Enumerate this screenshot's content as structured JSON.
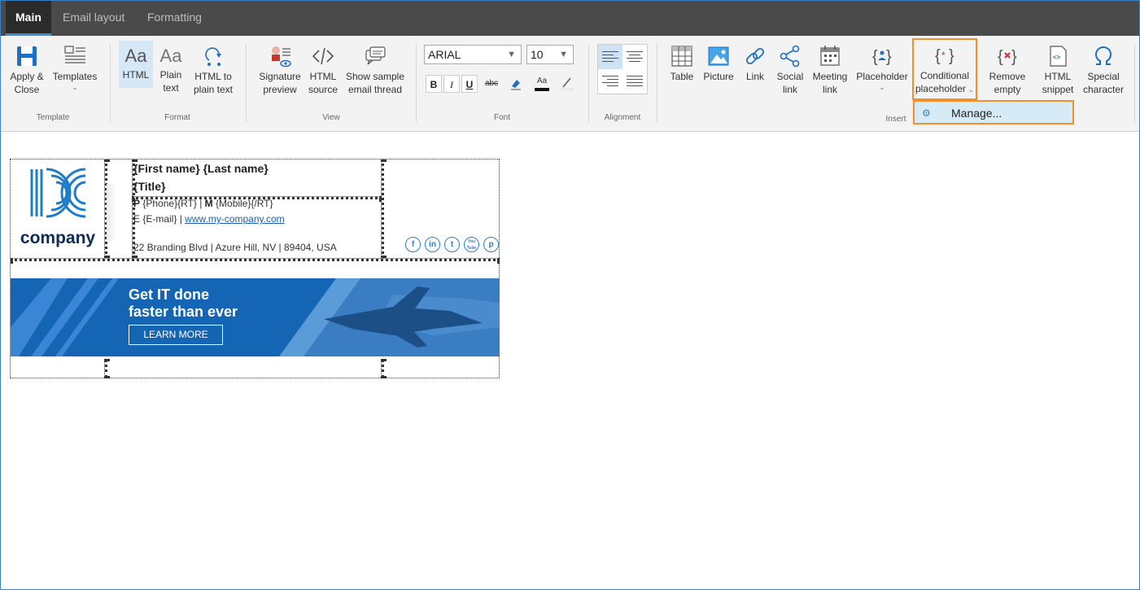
{
  "tabs": [
    "Main",
    "Email layout",
    "Formatting"
  ],
  "ribbon": {
    "template": {
      "apply_close": "Apply &\nClose",
      "templates": "Templates",
      "group_label": "Template"
    },
    "format": {
      "html": "HTML",
      "plain_text": "Plain\ntext",
      "html_to_plain": "HTML to\nplain text",
      "group_label": "Format"
    },
    "view": {
      "signature_preview": "Signature\npreview",
      "html_source": "HTML\nsource",
      "sample_thread": "Show sample\nemail thread",
      "group_label": "View"
    },
    "font": {
      "family": "ARIAL",
      "size": "10",
      "bold": "B",
      "italic": "I",
      "underline": "U",
      "strike": "abc",
      "group_label": "Font"
    },
    "alignment": {
      "group_label": "Alignment"
    },
    "insert": {
      "table": "Table",
      "picture": "Picture",
      "link": "Link",
      "social_link": "Social\nlink",
      "meeting_link": "Meeting\nlink",
      "placeholder": "Placeholder",
      "conditional_placeholder": "Conditional\nplaceholder",
      "remove_empty": "Remove\nempty",
      "html_snippet": "HTML\nsnippet",
      "special_character": "Special\ncharacter",
      "group_label": "Insert"
    }
  },
  "dropdown": {
    "manage": "Manage..."
  },
  "signature": {
    "logo_text": "company",
    "name": "{First name} {Last name}",
    "title": "{Title}",
    "phone_prefix": "P",
    "phone": "{Phone}{RT} |",
    "mobile_prefix": "M",
    "mobile": "{Mobile}{/RT}",
    "email_line": "E {E-mail} |",
    "website": "www.my-company.com",
    "address": "22 Branding Blvd | Azure Hill, NV | 89404, USA",
    "social_icons": [
      "f",
      "in",
      "t",
      "You\nTube",
      "p"
    ],
    "banner": {
      "headline": "Get IT done\nfaster than ever",
      "button": "LEARN MORE"
    }
  },
  "colors": {
    "tab_bar": "#4a4a4a",
    "accent": "#3b8fd6",
    "highlight": "#f0912e",
    "brand_blue": "#1565b5"
  }
}
